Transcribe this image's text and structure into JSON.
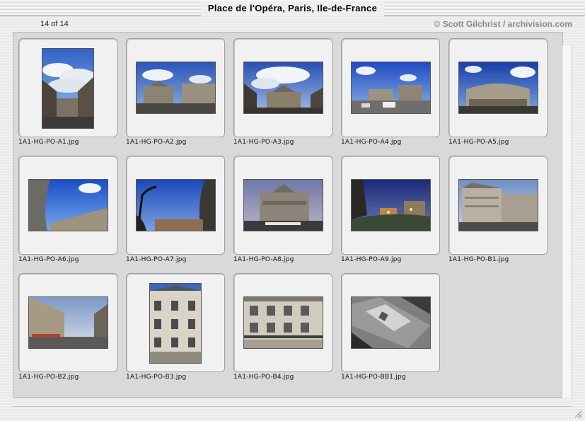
{
  "window": {
    "title": "Place de l'Opéra, Paris, Ile-de-France"
  },
  "header": {
    "counter": "14 of 14",
    "credit": "© Scott Gilchrist / archivision.com"
  },
  "thumbnails": [
    {
      "filename": "1A1-HG-PO-A1.jpg",
      "subject": "street-view-photo"
    },
    {
      "filename": "1A1-HG-PO-A2.jpg",
      "subject": "opera-facade-photo"
    },
    {
      "filename": "1A1-HG-PO-A3.jpg",
      "subject": "opera-facade-photo"
    },
    {
      "filename": "1A1-HG-PO-A4.jpg",
      "subject": "square-traffic-photo"
    },
    {
      "filename": "1A1-HG-PO-A5.jpg",
      "subject": "opera-wide-angle-photo"
    },
    {
      "filename": "1A1-HG-PO-A6.jpg",
      "subject": "sky-statue-photo"
    },
    {
      "filename": "1A1-HG-PO-A7.jpg",
      "subject": "sky-lamp-photo"
    },
    {
      "filename": "1A1-HG-PO-A8.jpg",
      "subject": "opera-dusk-photo"
    },
    {
      "filename": "1A1-HG-PO-A9.jpg",
      "subject": "square-night-photo"
    },
    {
      "filename": "1A1-HG-PO-B1.jpg",
      "subject": "corner-building-photo"
    },
    {
      "filename": "1A1-HG-PO-B2.jpg",
      "subject": "boulevard-photo"
    },
    {
      "filename": "1A1-HG-PO-B3.jpg",
      "subject": "facade-detail-photo"
    },
    {
      "filename": "1A1-HG-PO-B4.jpg",
      "subject": "facade-windows-photo"
    },
    {
      "filename": "1A1-HG-PO-BB1.jpg",
      "subject": "aerial-view-photo"
    }
  ]
}
